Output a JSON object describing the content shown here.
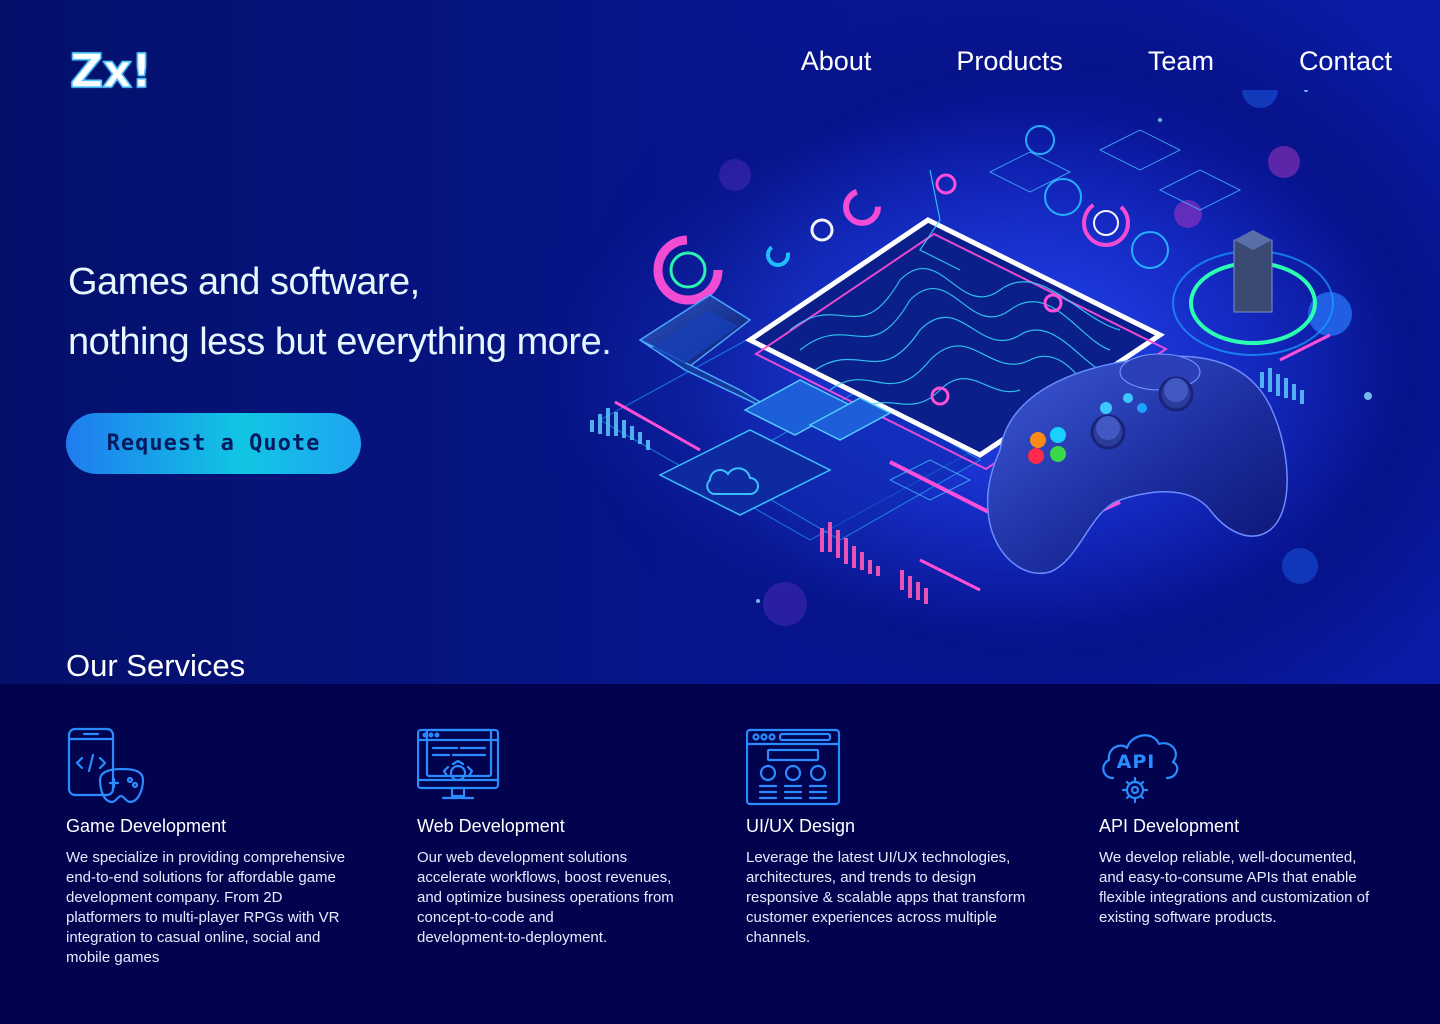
{
  "brand": {
    "logo": "Zx!"
  },
  "nav": {
    "items": [
      "About",
      "Products",
      "Team",
      "Contact"
    ]
  },
  "hero": {
    "headline_line1": "Games and software,",
    "headline_line2": "nothing less but everything more.",
    "cta_label": "Request a Quote"
  },
  "services": {
    "title": "Our Services",
    "items": [
      {
        "icon": "mobile-gamepad-icon",
        "name": "Game Development",
        "lines": [
          "We specialize in providing comprehensive",
          "end-to-end solutions for affordable game",
          "development company.  From 2D",
          "platformers to multi-player RPGs with VR",
          "integration to casual online, social and",
          "mobile games"
        ]
      },
      {
        "icon": "monitor-gear-icon",
        "name": "Web Development",
        "lines": [
          "Our  web development solutions",
          "accelerate workflows, boost revenues,",
          "and optimize business operations from",
          "concept-to-code and",
          "development-to-deployment."
        ]
      },
      {
        "icon": "browser-layout-icon",
        "name": "UI/UX Design",
        "lines": [
          "Leverage the latest UI/UX technologies,",
          "architectures, and trends to design",
          "responsive & scalable apps that transform",
          "customer experiences across multiple",
          "channels."
        ]
      },
      {
        "icon": "api-cloud-gear-icon",
        "name": "API Development",
        "lines": [
          "We develop reliable, well-documented,",
          "and easy-to-consume APIs that enable",
          "flexible integrations and customization of",
          "existing software products."
        ]
      }
    ]
  },
  "colors": {
    "accent_cyan": "#11c6e3",
    "accent_blue": "#1f7cf0",
    "background": "#02034f",
    "icon_blue": "#2a8cff"
  }
}
